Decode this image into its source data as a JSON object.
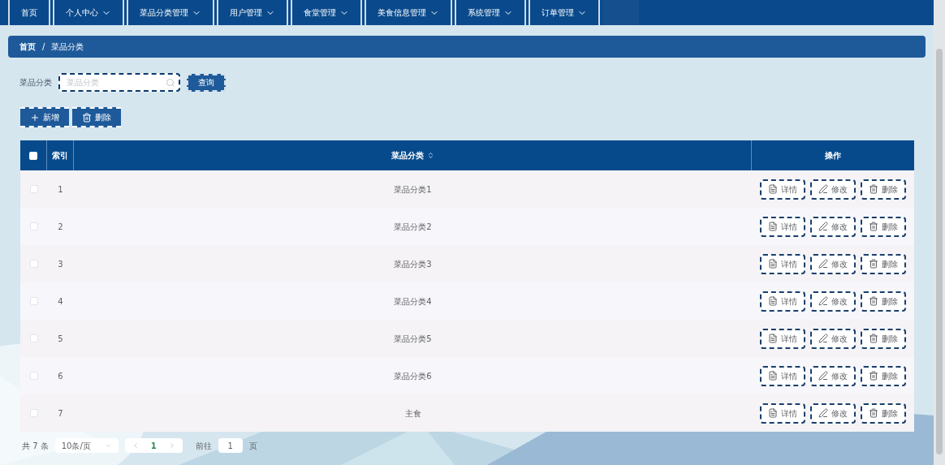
{
  "nav": [
    {
      "label": "首页",
      "dropdown": false
    },
    {
      "label": "个人中心",
      "dropdown": true
    },
    {
      "label": "菜品分类管理",
      "dropdown": true
    },
    {
      "label": "用户管理",
      "dropdown": true
    },
    {
      "label": "食堂管理",
      "dropdown": true
    },
    {
      "label": "美食信息管理",
      "dropdown": true
    },
    {
      "label": "系统管理",
      "dropdown": true
    },
    {
      "label": "订单管理",
      "dropdown": true
    }
  ],
  "breadcrumb": [
    "首页",
    "/",
    "菜品分类"
  ],
  "search": {
    "label": "菜品分类",
    "placeholder": "菜品分类",
    "button": "查询"
  },
  "toolbar": [
    {
      "kind": "add",
      "label": "新增"
    },
    {
      "kind": "delete",
      "label": "删除"
    }
  ],
  "table": {
    "header_checked": false,
    "columns": [
      "索引",
      "菜品分类",
      "操作"
    ],
    "rows": [
      {
        "checked": false,
        "index": "1",
        "name": "菜品分类1",
        "actions": [
          {
            "kind": "detail",
            "label": "详情"
          },
          {
            "kind": "edit",
            "label": "修改"
          },
          {
            "kind": "delete",
            "label": "删除"
          }
        ]
      },
      {
        "checked": false,
        "index": "2",
        "name": "菜品分类2",
        "actions": [
          {
            "kind": "detail",
            "label": "详情"
          },
          {
            "kind": "edit",
            "label": "修改"
          },
          {
            "kind": "delete",
            "label": "删除"
          }
        ]
      },
      {
        "checked": false,
        "index": "3",
        "name": "菜品分类3",
        "actions": [
          {
            "kind": "detail",
            "label": "详情"
          },
          {
            "kind": "edit",
            "label": "修改"
          },
          {
            "kind": "delete",
            "label": "删除"
          }
        ]
      },
      {
        "checked": false,
        "index": "4",
        "name": "菜品分类4",
        "actions": [
          {
            "kind": "detail",
            "label": "详情"
          },
          {
            "kind": "edit",
            "label": "修改"
          },
          {
            "kind": "delete",
            "label": "删除"
          }
        ]
      },
      {
        "checked": false,
        "index": "5",
        "name": "菜品分类5",
        "actions": [
          {
            "kind": "detail",
            "label": "详情"
          },
          {
            "kind": "edit",
            "label": "修改"
          },
          {
            "kind": "delete",
            "label": "删除"
          }
        ]
      },
      {
        "checked": false,
        "index": "6",
        "name": "菜品分类6",
        "actions": [
          {
            "kind": "detail",
            "label": "详情"
          },
          {
            "kind": "edit",
            "label": "修改"
          },
          {
            "kind": "delete",
            "label": "删除"
          }
        ]
      },
      {
        "checked": false,
        "index": "7",
        "name": "主食",
        "actions": [
          {
            "kind": "detail",
            "label": "详情"
          },
          {
            "kind": "edit",
            "label": "修改"
          },
          {
            "kind": "delete",
            "label": "删除"
          }
        ]
      }
    ]
  },
  "pagination": {
    "total": "共 7 条",
    "page_size": "10条/页",
    "pages": [
      {
        "label": "1",
        "selected": true
      }
    ],
    "goto_label": "前往",
    "goto_value": "1",
    "goto_suffix": "页"
  }
}
